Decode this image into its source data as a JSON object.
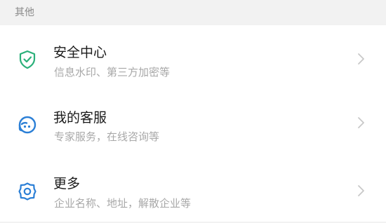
{
  "section": {
    "header": "其他"
  },
  "items": [
    {
      "title": "安全中心",
      "subtitle": "信息水印、第三方加密等",
      "icon": "shield-check-icon",
      "icon_color": "#2bb07a"
    },
    {
      "title": "我的客服",
      "subtitle": "专家服务，在线咨询等",
      "icon": "customer-service-icon",
      "icon_color": "#2b7fd6"
    },
    {
      "title": "更多",
      "subtitle": "企业名称、地址，解散企业等",
      "icon": "gear-icon",
      "icon_color": "#2b7fd6"
    }
  ],
  "colors": {
    "background": "#f2f2f2",
    "card": "#ffffff",
    "title": "#1a1a1a",
    "subtitle": "#a8a8a8",
    "header": "#8a8a8a",
    "chevron": "#c8c8c8"
  }
}
